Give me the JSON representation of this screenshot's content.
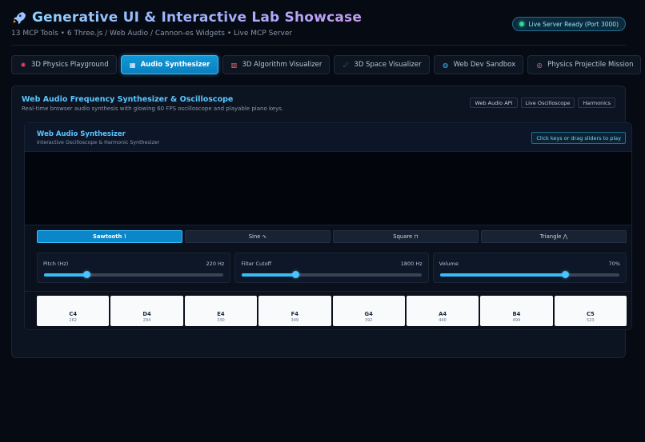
{
  "header": {
    "title": "Generative UI & Interactive Lab Showcase",
    "subtitle": "13 MCP Tools • 6 Three.js / Web Audio / Cannon-es Widgets • Live MCP Server",
    "server_status": "Live Server Ready (Port 3000)"
  },
  "tabs": [
    {
      "icon": "atom-icon",
      "label": "3D Physics Playground",
      "active": false
    },
    {
      "icon": "keyboard-icon",
      "label": "Audio Synthesizer",
      "active": true
    },
    {
      "icon": "bars-icon",
      "label": "3D Algorithm Visualizer",
      "active": false
    },
    {
      "icon": "space-icon",
      "label": "3D Space Visualizer",
      "active": false
    },
    {
      "icon": "globe-icon",
      "label": "Web Dev Sandbox",
      "active": false
    },
    {
      "icon": "target-icon",
      "label": "Physics Projectile Mission",
      "active": false
    }
  ],
  "panel": {
    "title": "Web Audio Frequency Synthesizer & Oscilloscope",
    "description": "Real-time browser audio synthesis with glowing 60 FPS oscilloscope and playable piano keys.",
    "tags": [
      "Web Audio API",
      "Live Oscilloscope",
      "Harmonics"
    ]
  },
  "synth": {
    "title": "Web Audio Synthesizer",
    "subtitle": "Interactive Oscilloscope & Harmonic Synthesizer",
    "hint": "Click keys or drag sliders to play",
    "waveforms": [
      {
        "label": "Sawtooth ⌇",
        "active": true
      },
      {
        "label": "Sine ∿",
        "active": false
      },
      {
        "label": "Square ⊓",
        "active": false
      },
      {
        "label": "Triangle ⋀",
        "active": false
      }
    ],
    "sliders": [
      {
        "label": "Pitch (Hz)",
        "value": "220 Hz",
        "fraction": 0.24
      },
      {
        "label": "Filter Cutoff",
        "value": "1800 Hz",
        "fraction": 0.3
      },
      {
        "label": "Volume",
        "value": "70%",
        "fraction": 0.7
      }
    ],
    "keys": [
      {
        "note": "C4",
        "freq": "262"
      },
      {
        "note": "D4",
        "freq": "294"
      },
      {
        "note": "E4",
        "freq": "330"
      },
      {
        "note": "F4",
        "freq": "349"
      },
      {
        "note": "G4",
        "freq": "392"
      },
      {
        "note": "A4",
        "freq": "440"
      },
      {
        "note": "B4",
        "freq": "494"
      },
      {
        "note": "C5",
        "freq": "523"
      }
    ]
  },
  "colors": {
    "accent": "#38bdf8",
    "background": "#060a13",
    "panel": "#0c1422",
    "status": "#34d399"
  }
}
